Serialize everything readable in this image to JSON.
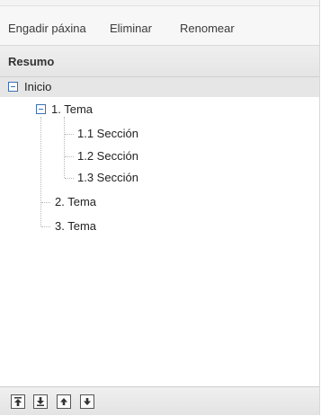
{
  "toolbar": {
    "add_page": "Engadir páxina",
    "delete": "Eliminar",
    "rename": "Renomear"
  },
  "header": {
    "title": "Resumo"
  },
  "tree": {
    "root": {
      "label": "Inicio",
      "expanded": true,
      "selected": true
    },
    "topic1": {
      "label": "1. Tema",
      "expanded": true,
      "children": [
        "1.1 Sección",
        "1.2 Sección",
        "1.3 Sección"
      ]
    },
    "topic2": {
      "label": "2. Tema"
    },
    "topic3": {
      "label": "3. Tema"
    }
  },
  "footer": {
    "buttons": [
      "move-top-icon",
      "move-bottom-icon",
      "move-up-icon",
      "move-down-icon"
    ]
  },
  "colors": {
    "toggle_border": "#3d6fb4",
    "selected_row": "#e6e6e6"
  }
}
